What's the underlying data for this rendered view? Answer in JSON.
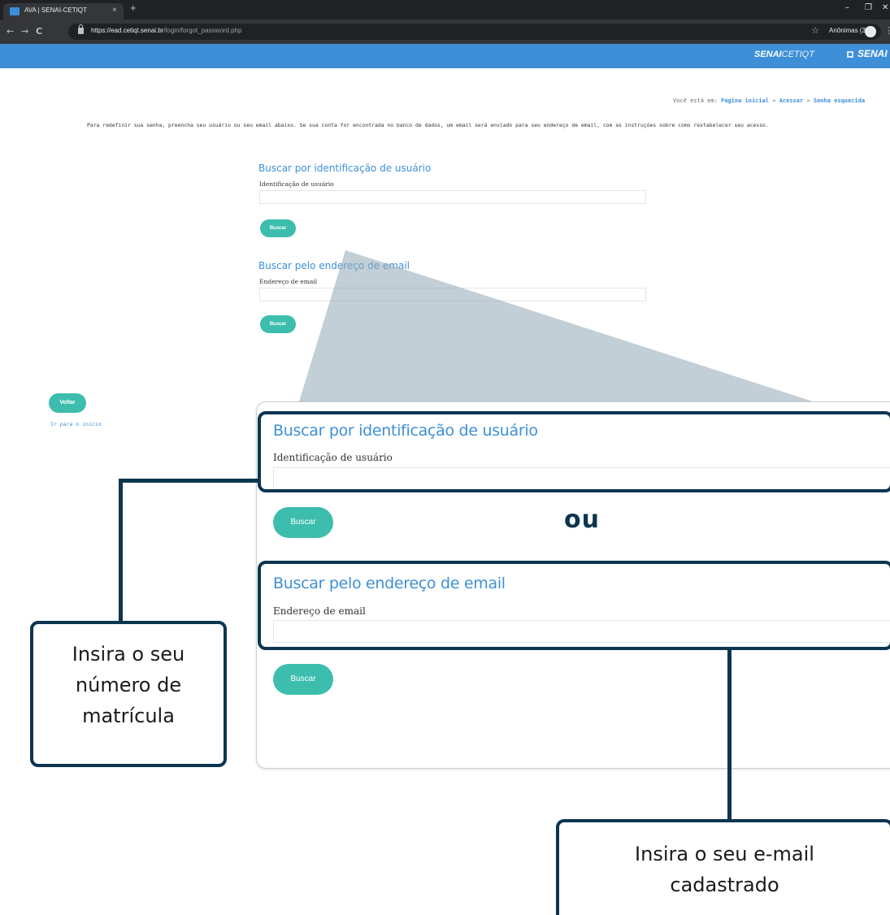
{
  "browser": {
    "tab_title": "AVA | SENAI-CETIQT",
    "tab_close": "×",
    "new_tab": "+",
    "minimize": "–",
    "restore": "❐",
    "close": "✕",
    "back": "←",
    "forward": "→",
    "reload": "C",
    "url_host": "https://ead.cetiqt.senai.br",
    "url_path": "/login/forgot_password.php",
    "star": "☆",
    "profile": "Anônimas (3)",
    "menu": "⋮"
  },
  "header": {
    "brand_bold": "SENAI",
    "brand_light": "CETIQT",
    "brand_right": "SENAI"
  },
  "page": {
    "breadcrumb_prefix": "Você está em:",
    "breadcrumb_home": "Página inicial",
    "breadcrumb_sep1": "»",
    "breadcrumb_access": "Acessar",
    "breadcrumb_sep2": "»",
    "breadcrumb_current": "Senha esquecida",
    "instructions": "Para redefinir sua senha, preencha seu usuário ou seu email abaixo. Se sua conta for encontrada no banco de dados, um email será enviado para seu endereço de email, com as instruções sobre como restabelecer seu acesso.",
    "section_user_title": "Buscar por identificação de usuário",
    "user_label": "Identificação de usuário",
    "user_value": "",
    "section_email_title": "Buscar pelo endereço de email",
    "email_label": "Endereço de email",
    "email_value": "",
    "search_button": "Buscar",
    "back_button": "Voltar",
    "home_link": "Ir para o início"
  },
  "zoom": {
    "section_user_title": "Buscar por identificação de usuário",
    "user_label": "Identificação de usuário",
    "section_email_title": "Buscar pelo endereço de email",
    "email_label": "Endereço de email",
    "search_button": "Buscar",
    "or_text": "ou"
  },
  "callouts": {
    "left_line1": "Insira o seu",
    "left_line2": "número de",
    "left_line3": "matrícula",
    "right_line1": "Insira o seu e-mail",
    "right_line2": "cadastrado"
  },
  "colors": {
    "accent_blue": "#3d8fd8",
    "button_teal": "#3dbdae",
    "callout_navy": "#0c3550"
  }
}
